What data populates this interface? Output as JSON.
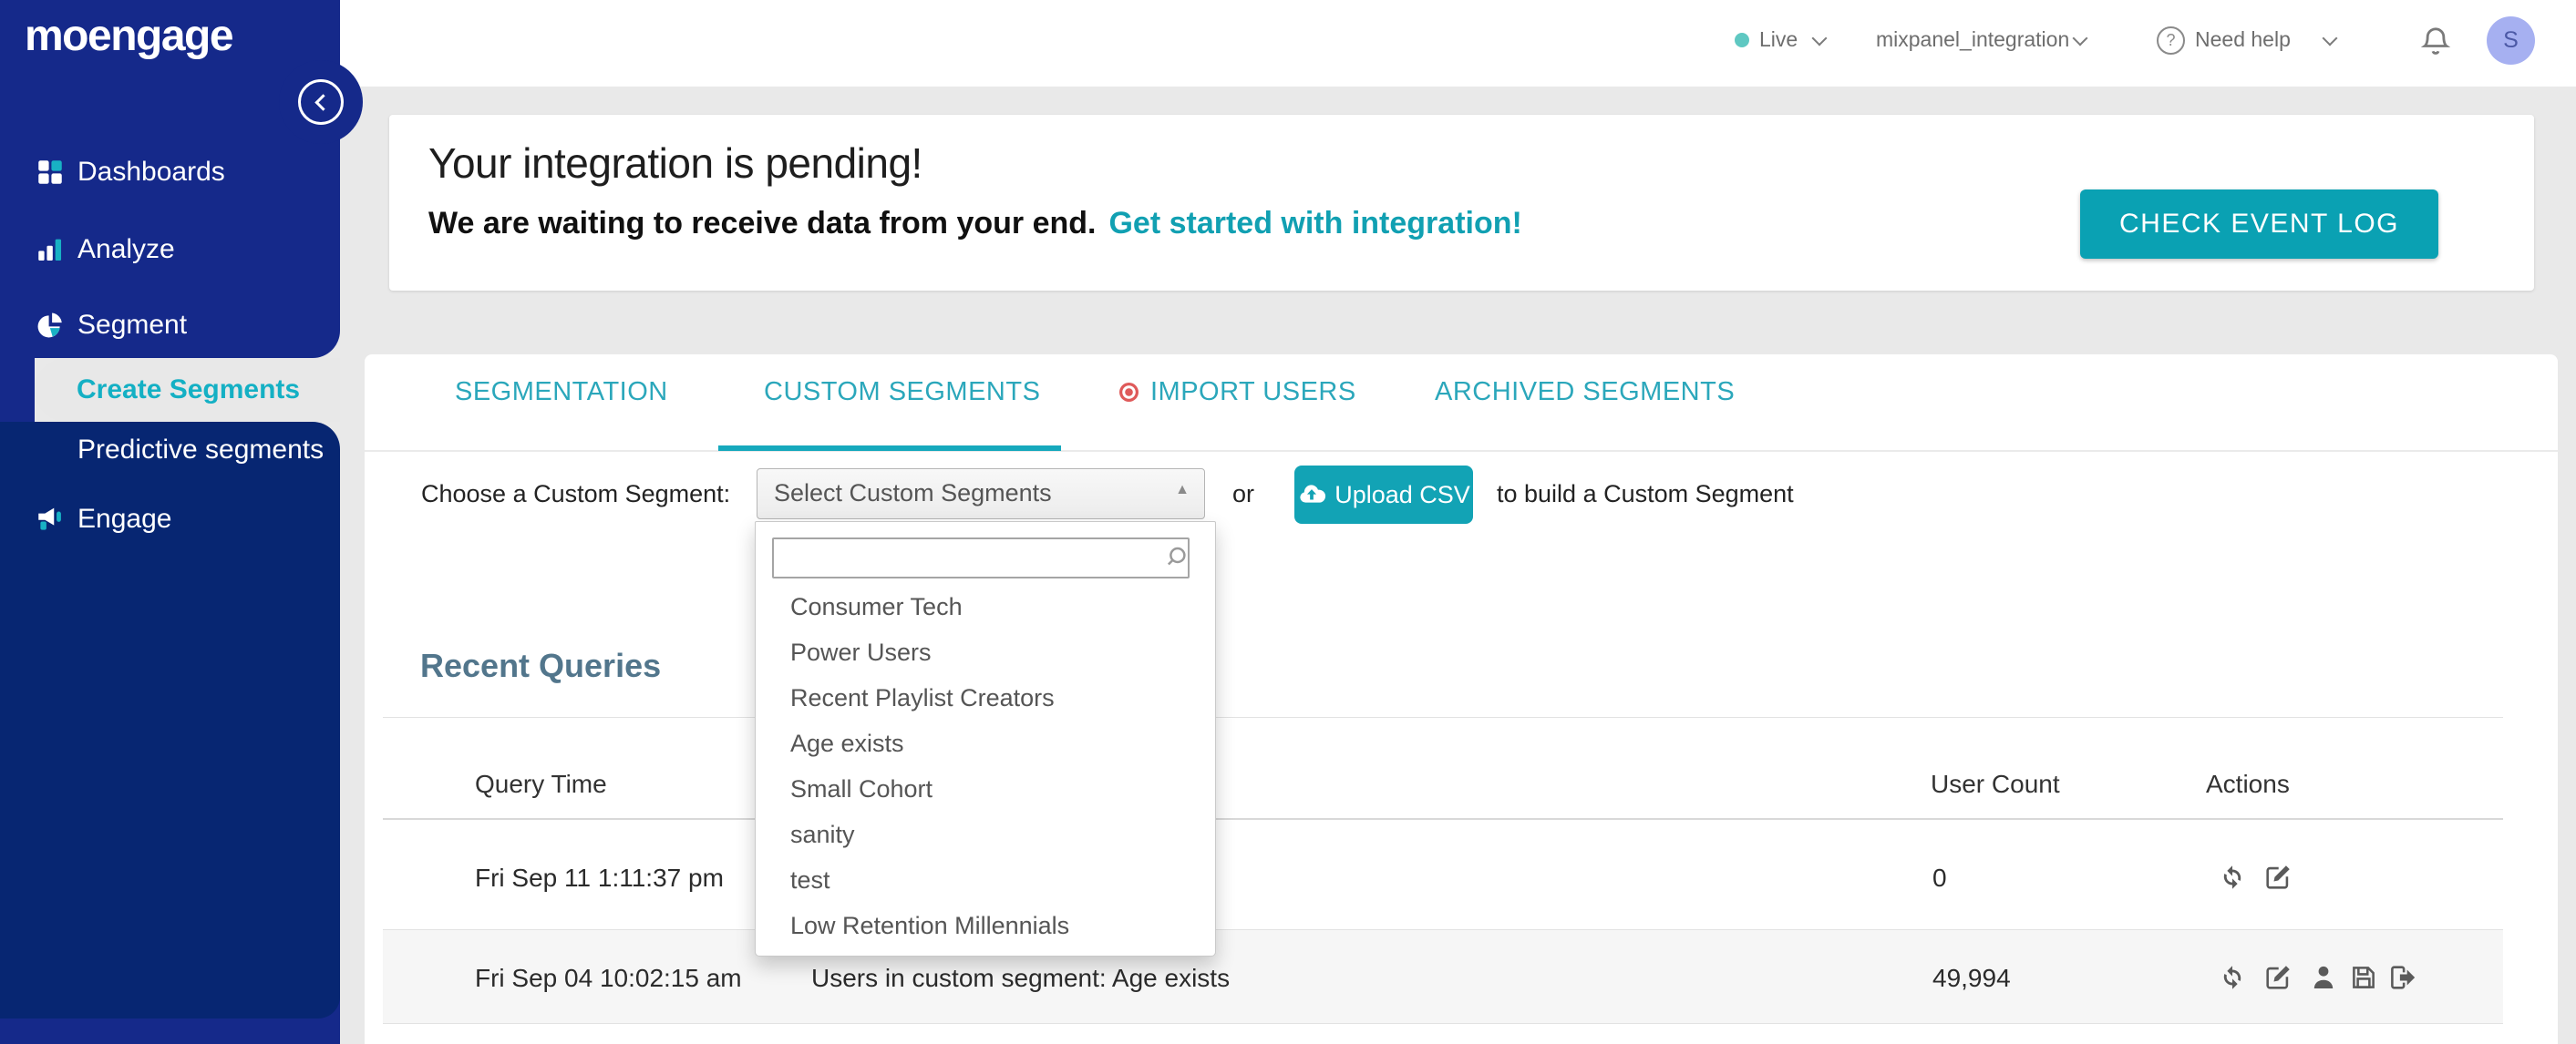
{
  "header": {
    "status": {
      "label": "Live"
    },
    "workspace": "mixpanel_integration",
    "help_label": "Need help",
    "help_glyph": "?",
    "avatar_initial": "S"
  },
  "sidebar": {
    "logo": "moengage",
    "items": [
      {
        "label": "Dashboards",
        "icon": "grid-icon"
      },
      {
        "label": "Analyze",
        "icon": "bar-chart-icon"
      },
      {
        "label": "Segment",
        "icon": "pie-chart-icon"
      },
      {
        "label": "Create Segments",
        "active": true
      },
      {
        "label": "Predictive segments"
      },
      {
        "label": "Engage",
        "icon": "megaphone-icon"
      }
    ]
  },
  "banner": {
    "title": "Your integration is pending!",
    "subtitle": "We are waiting to receive data from your end.",
    "link_text": "Get started with integration!",
    "button_label": "CHECK EVENT LOG"
  },
  "tabs": [
    {
      "label": "SEGMENTATION"
    },
    {
      "label": "CUSTOM SEGMENTS",
      "active": true
    },
    {
      "label": "IMPORT USERS",
      "badge": "red-dot"
    },
    {
      "label": "ARCHIVED SEGMENTS"
    }
  ],
  "picker": {
    "label": "Choose a Custom Segment:",
    "select_value": "Select Custom Segments",
    "caret": "▲",
    "or_text": "or",
    "upload_label": "Upload CSV",
    "suffix_text": "to build a Custom Segment",
    "search_value": "",
    "options": [
      "Consumer Tech",
      "Power Users",
      "Recent Playlist Creators",
      "Age exists",
      "Small Cohort",
      "sanity",
      "test",
      "Low Retention Millennials"
    ]
  },
  "recent": {
    "title": "Recent Queries",
    "columns": [
      {
        "label": "Query Time"
      },
      {
        "label": "User Count"
      },
      {
        "label": "Actions"
      }
    ],
    "rows": [
      {
        "query_time": "Fri Sep 11 1:11:37 pm",
        "user_count": "0"
      },
      {
        "query_time": "Fri Sep 04 10:02:15 am",
        "query": "Users in custom segment: Age exists",
        "user_count": "49,994"
      }
    ]
  },
  "colors": {
    "teal": "#12a3b5",
    "navy": "#15298a",
    "navy_dark": "#072672",
    "live_dot": "#5fc8c2",
    "import_dot": "#df5a5a",
    "avatar_bg": "#a6b0f1"
  }
}
